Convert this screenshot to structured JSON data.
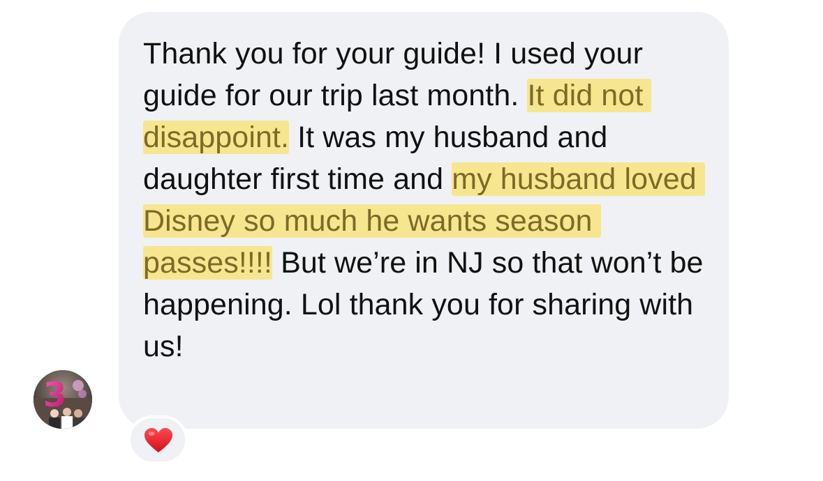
{
  "message": {
    "segments": [
      {
        "text": "Thank you for your guide! I used your guide for our trip last month. ",
        "highlighted": false
      },
      {
        "text": "It did not disappoint.",
        "highlighted": true
      },
      {
        "text": " It was my husband and daughter first time and ",
        "highlighted": false
      },
      {
        "text": "my husband loved Disney so much he wants season passes!!!!",
        "highlighted": true
      },
      {
        "text": " But we’re in NJ so that won’t be happening. Lol thank you for sharing with us!",
        "highlighted": false
      }
    ]
  },
  "sender": {
    "avatar_badge": "3"
  },
  "reaction": {
    "icon": "red-heart-icon",
    "color": "#e8232f"
  },
  "colors": {
    "bubble": "#f0f1f4",
    "highlight": "#f6e690",
    "highlight_text": "#7d6a26",
    "text": "#111111"
  }
}
